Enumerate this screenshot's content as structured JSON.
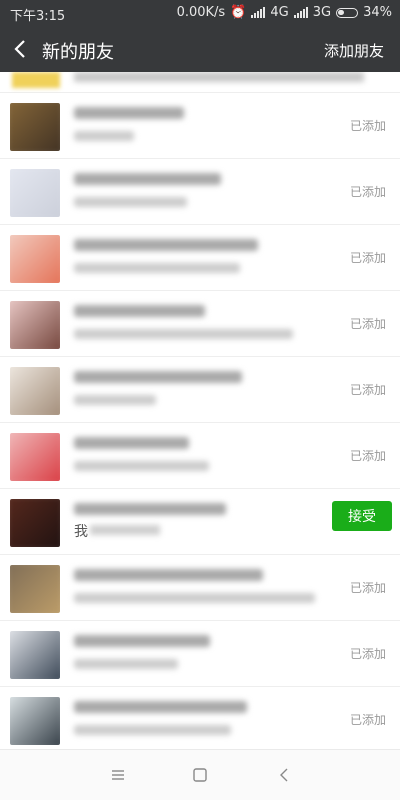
{
  "status_bar": {
    "time": "下午3:15",
    "network_speed": "0.00K/s",
    "network_1": "4G",
    "network_2": "3G",
    "battery": "34%"
  },
  "header": {
    "title": "新的朋友",
    "action": "添加朋友"
  },
  "list": {
    "rows": [
      {
        "status": "已添加",
        "colors": [
          "#8a6a3a",
          "#3c2e22"
        ]
      },
      {
        "status": "已添加",
        "colors": [
          "#e6e9f2",
          "#c9cdd8"
        ]
      },
      {
        "status": "已添加",
        "colors": [
          "#f3d3c8",
          "#e36a4e"
        ]
      },
      {
        "status": "已添加",
        "colors": [
          "#f2d2d0",
          "#6a3a30"
        ]
      },
      {
        "status": "已添加",
        "colors": [
          "#f4efe8",
          "#9c8570"
        ]
      },
      {
        "status": "已添加",
        "colors": [
          "#f2c3c3",
          "#d7333a"
        ]
      },
      {
        "status": "接受",
        "subtext": "我",
        "colors": [
          "#5a2a1e",
          "#1c1010"
        ]
      },
      {
        "status": "已添加",
        "colors": [
          "#7b6a55",
          "#c2a16a"
        ]
      },
      {
        "status": "已添加",
        "colors": [
          "#eef0f4",
          "#2d3a4a"
        ]
      },
      {
        "status": "已添加",
        "colors": [
          "#e9f0f2",
          "#27313a"
        ]
      }
    ]
  },
  "colors": {
    "header_bg": "#37393b",
    "accept_green": "#1aad19",
    "status_gray": "#9a9a9a"
  }
}
